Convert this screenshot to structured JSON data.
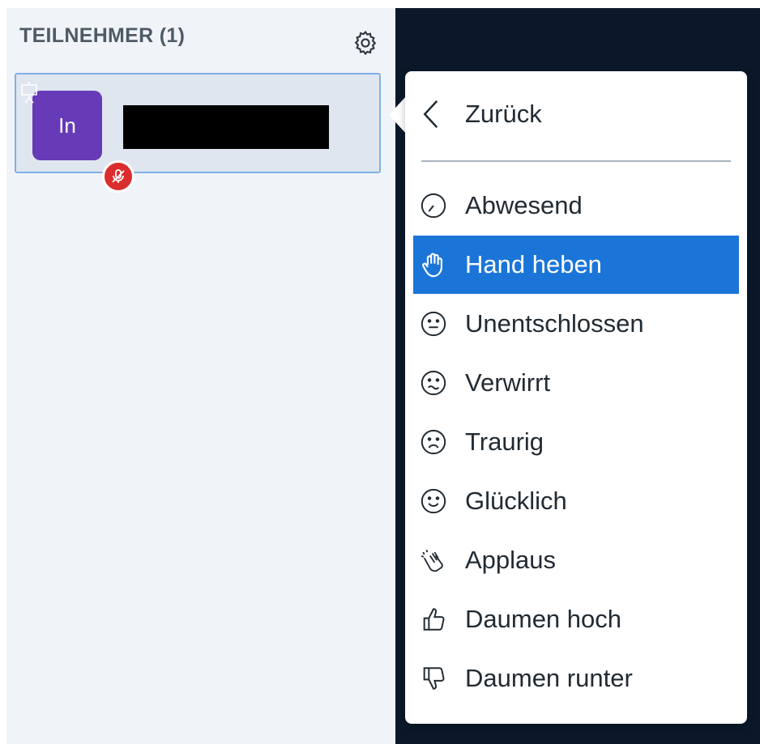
{
  "panel": {
    "title": "TEILNEHMER (1)"
  },
  "user": {
    "initials": "In",
    "name_redacted": "",
    "muted": true
  },
  "menu": {
    "back_label": "Zurück",
    "items": [
      {
        "label": "Abwesend",
        "icon": "clock-icon"
      },
      {
        "label": "Hand heben",
        "icon": "raised-hand-icon",
        "active": true
      },
      {
        "label": "Unentschlossen",
        "icon": "neutral-face-icon"
      },
      {
        "label": "Verwirrt",
        "icon": "confused-face-icon"
      },
      {
        "label": "Traurig",
        "icon": "sad-face-icon"
      },
      {
        "label": "Glücklich",
        "icon": "happy-face-icon"
      },
      {
        "label": "Applaus",
        "icon": "clapping-hands-icon"
      },
      {
        "label": "Daumen hoch",
        "icon": "thumbs-up-icon"
      },
      {
        "label": "Daumen runter",
        "icon": "thumbs-down-icon"
      }
    ]
  },
  "colors": {
    "accent": "#1b75d9",
    "avatar": "#673ab7",
    "mute_badge": "#db2d2d",
    "dark_bg": "#0a1829"
  }
}
